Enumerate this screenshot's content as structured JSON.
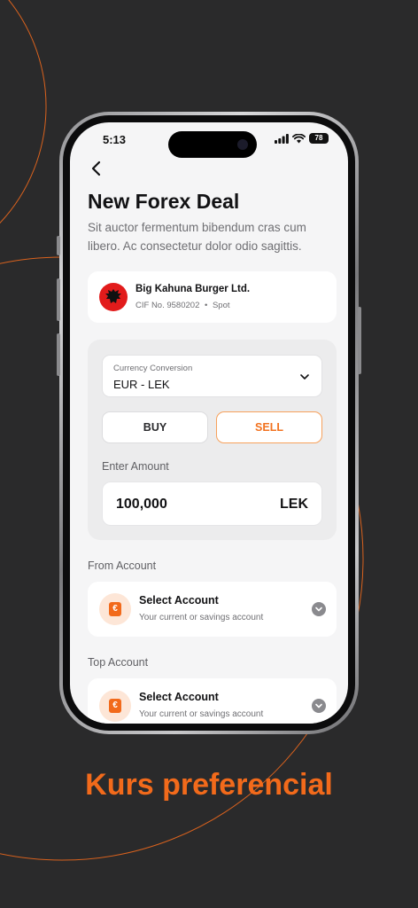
{
  "status_bar": {
    "time": "5:13",
    "battery": "78"
  },
  "screen": {
    "title": "New Forex Deal",
    "subtitle": "Sit auctor fermentum bibendum cras cum libero. Ac consectetur dolor odio sagittis."
  },
  "company": {
    "name": "Big Kahuna Burger Ltd.",
    "cif": "CIF No. 9580202",
    "separator": "•",
    "type": "Spot"
  },
  "conversion": {
    "label": "Currency Conversion",
    "value": "EUR - LEK"
  },
  "actions": {
    "buy": "BUY",
    "sell": "SELL",
    "selected": "SELL"
  },
  "amount": {
    "label": "Enter Amount",
    "value": "100,000",
    "currency": "LEK"
  },
  "from_account": {
    "section_label": "From Account",
    "title": "Select Account",
    "subtitle": "Your current or savings account"
  },
  "top_account": {
    "section_label": "Top Account",
    "title": "Select Account",
    "subtitle": "Your current or savings account"
  },
  "tagline": "Kurs preferencial",
  "colors": {
    "accent": "#f26a1b",
    "background": "#2a2a2b",
    "screen": "#f5f5f6"
  }
}
